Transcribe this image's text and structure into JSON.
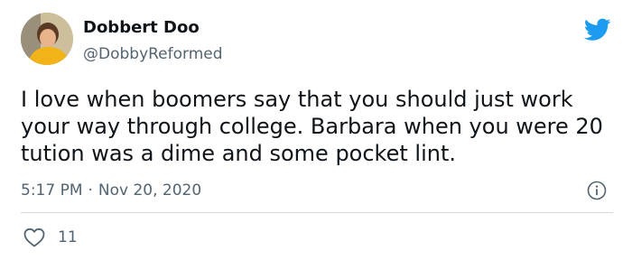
{
  "author": {
    "display_name": "Dobbert Doo",
    "handle": "@DobbyReformed"
  },
  "tweet": {
    "text": "I love when boomers say that you should just work your way through college. Barbara when you were 20 tution was a dime and some pocket lint.",
    "time": "5:17 PM",
    "separator": "·",
    "date": "Nov 20, 2020",
    "like_count": "11"
  },
  "colors": {
    "twitter_blue": "#1d9bf0",
    "secondary_text": "#536471"
  },
  "icons": [
    "twitter-bird-icon",
    "info-icon",
    "heart-icon"
  ]
}
